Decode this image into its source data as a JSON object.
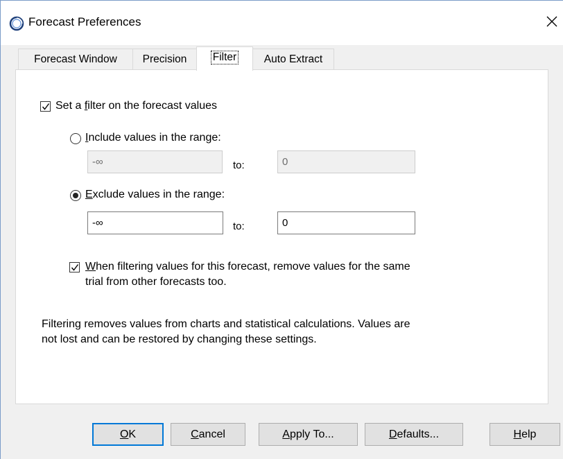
{
  "window": {
    "title": "Forecast Preferences"
  },
  "tabs": [
    {
      "label": "Forecast Window",
      "active": false
    },
    {
      "label": "Precision",
      "active": false
    },
    {
      "label": "Filter",
      "active": true
    },
    {
      "label": "Auto Extract",
      "active": false
    }
  ],
  "filter": {
    "set_filter": {
      "checked": true,
      "pre": "Set a ",
      "accel": "f",
      "post": "ilter on the forecast values"
    },
    "include": {
      "selected": false,
      "accel": "I",
      "post": "nclude values in the range:",
      "from": "-∞",
      "to_label": "to:",
      "to": "0"
    },
    "exclude": {
      "selected": true,
      "accel": "E",
      "post": "xclude values in the range:",
      "from": "-∞",
      "to_label": "to:",
      "to": "0"
    },
    "remove_trials": {
      "checked": true,
      "accel": "W",
      "line1_post": "hen filtering values for this forecast, remove values for the same",
      "line2": "trial from other forecasts too."
    },
    "note_line1": "Filtering removes values from charts and statistical calculations.  Values are",
    "note_line2": "not lost and can be restored by changing these settings."
  },
  "buttons": {
    "ok": {
      "accel": "O",
      "post": "K"
    },
    "cancel": {
      "accel": "C",
      "post": "ancel"
    },
    "apply_to": {
      "accel": "A",
      "post": "pply To..."
    },
    "defaults": {
      "accel": "D",
      "post": "efaults..."
    },
    "help": {
      "accel": "H",
      "post": "elp"
    }
  }
}
